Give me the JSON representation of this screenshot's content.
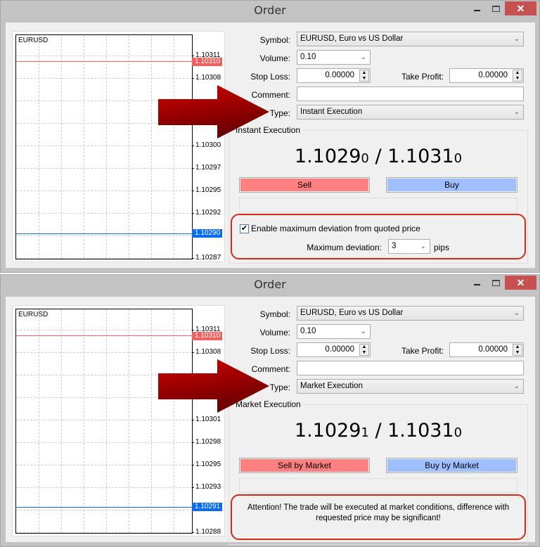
{
  "windows": [
    {
      "title": "Order",
      "chart": {
        "symbol": "EURUSD",
        "ticks": [
          "1.10311",
          "1.10308",
          "",
          "",
          "1.10300",
          "1.10297",
          "1.10295",
          "1.10292",
          "",
          "1.10287"
        ],
        "ask": "1.10310",
        "bid": "1.10290"
      },
      "form": {
        "symbol_label": "Symbol:",
        "symbol_value": "EURUSD, Euro vs US Dollar",
        "volume_label": "Volume:",
        "volume_value": "0.10",
        "stoploss_label": "Stop Loss:",
        "stoploss_value": "0.00000",
        "takeprofit_label": "Take Profit:",
        "takeprofit_value": "0.00000",
        "comment_label": "Comment:",
        "comment_value": "",
        "type_label": "Type:",
        "type_value": "Instant Execution"
      },
      "execution": {
        "group_label": "Instant Execution",
        "bid_main": "1.1029",
        "bid_small": "0",
        "separator": " / ",
        "ask_main": "1.1031",
        "ask_small": "0",
        "sell_label": "Sell",
        "buy_label": "Buy"
      },
      "deviation": {
        "checkbox_label": "Enable maximum deviation from quoted price",
        "checked": true,
        "max_label": "Maximum deviation:",
        "max_value": "3",
        "unit": "pips"
      }
    },
    {
      "title": "Order",
      "chart": {
        "symbol": "EURUSD",
        "ticks": [
          "1.10311",
          "1.10308",
          "",
          "",
          "1.10301",
          "1.10298",
          "1.10295",
          "1.10293",
          "",
          "1.10288"
        ],
        "ask": "1.10310",
        "bid": "1.10291"
      },
      "form": {
        "symbol_label": "Symbol:",
        "symbol_value": "EURUSD, Euro vs US Dollar",
        "volume_label": "Volume:",
        "volume_value": "0.10",
        "stoploss_label": "Stop Loss:",
        "stoploss_value": "0.00000",
        "takeprofit_label": "Take Profit:",
        "takeprofit_value": "0.00000",
        "comment_label": "Comment:",
        "comment_value": "",
        "type_label": "Type:",
        "type_value": "Market Execution"
      },
      "execution": {
        "group_label": "Market Execution",
        "bid_main": "1.1029",
        "bid_small": "1",
        "separator": " / ",
        "ask_main": "1.1031",
        "ask_small": "0",
        "sell_label": "Sell by Market",
        "buy_label": "Buy by Market"
      },
      "attention": "Attention! The trade will be executed at market conditions, difference with requested price may be significant!"
    }
  ],
  "icons": {
    "close": "✕",
    "chevron": "⌄",
    "check": "✔"
  },
  "colors": {
    "sell": "#ff8080",
    "buy": "#a0bfff",
    "ask_line": "#f06060",
    "bid_line": "#0a6cf0",
    "highlight": "#d42a14",
    "arrow": "#a00000",
    "close_button": "#c75050"
  }
}
